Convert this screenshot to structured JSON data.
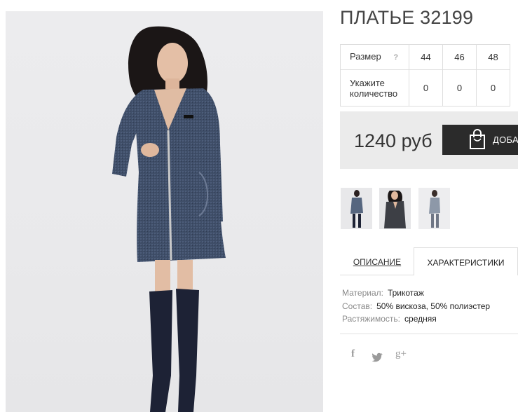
{
  "product": {
    "title": "ПЛАТЬЕ 32199",
    "main_image": "woman-in-blue-zip-dress-photo"
  },
  "size_table": {
    "size_label": "Размер",
    "help_icon": "?",
    "sizes": [
      "44",
      "46",
      "48"
    ],
    "qty_label_line1": "Укажите",
    "qty_label_line2": "количество",
    "quantities": [
      "0",
      "0",
      "0"
    ]
  },
  "purchase": {
    "price": "1240 руб",
    "buy_label": "ДОБАВИТЬ",
    "bag_icon": "shopping-bag-icon"
  },
  "thumbnails": [
    "thumb-model-full-length",
    "thumb-model-dark-dress",
    "thumb-model-light"
  ],
  "tabs": {
    "description": "ОПИСАНИЕ",
    "characteristics": "ХАРАКТЕРИСТИКИ"
  },
  "characteristics": [
    {
      "key": "Материал:",
      "value": "Трикотаж"
    },
    {
      "key": "Состав:",
      "value": "50% вискоза, 50% полиэстер"
    },
    {
      "key": "Растяжимость:",
      "value": "средняя"
    }
  ],
  "social": {
    "facebook": "f",
    "twitter": "twitter-icon",
    "google_plus": "g+"
  },
  "colors": {
    "dress": "#3f4e68",
    "boots": "#1d2235",
    "button": "#2b2b2b",
    "price_bg": "#ebebeb"
  }
}
